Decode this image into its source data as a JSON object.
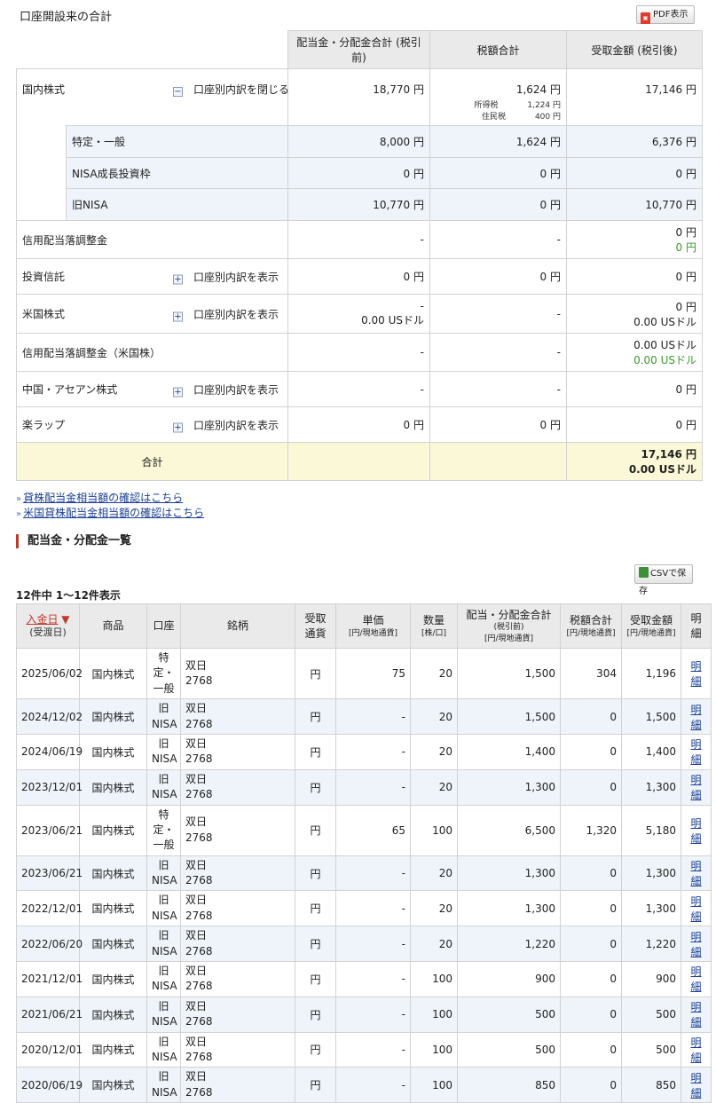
{
  "summary": {
    "title": "口座開設来の合計",
    "pdf_label": "PDF表示",
    "headers": {
      "dividend": "配当金・分配金合計 (税引前)",
      "tax": "税額合計",
      "received": "受取金額 (税引後)"
    },
    "domestic": {
      "label": "国内株式",
      "toggle": "口座別内訳を閉じる",
      "dividend": "18,770 円",
      "tax": "1,624 円",
      "income_tax_label": "所得税",
      "income_tax": "1,224 円",
      "resident_tax_label": "住民税",
      "resident_tax": "400 円",
      "received": "17,146 円",
      "accounts": [
        {
          "label": "特定・一般",
          "dividend": "8,000 円",
          "tax": "1,624 円",
          "received": "6,376 円"
        },
        {
          "label": "NISA成長投資枠",
          "dividend": "0 円",
          "tax": "0 円",
          "received": "0 円"
        },
        {
          "label": "旧NISA",
          "dividend": "10,770 円",
          "tax": "0 円",
          "received": "10,770 円"
        }
      ]
    },
    "margin_adj": {
      "label": "信用配当落調整金",
      "dividend": "-",
      "tax": "-",
      "received": "0 円",
      "received_green": "0 円"
    },
    "trust": {
      "label": "投資信託",
      "toggle": "口座別内訳を表示",
      "dividend": "0 円",
      "tax": "0 円",
      "received": "0 円"
    },
    "us": {
      "label": "米国株式",
      "toggle": "口座別内訳を表示",
      "dividend": "-",
      "dividend_usd": "0.00 USドル",
      "tax": "-",
      "received": "0 円",
      "received_usd": "0.00 USドル"
    },
    "us_margin_adj": {
      "label": "信用配当落調整金（米国株）",
      "dividend": "-",
      "tax": "-",
      "received": "0.00 USドル",
      "received_green": "0.00 USドル"
    },
    "asean": {
      "label": "中国・アセアン株式",
      "toggle": "口座別内訳を表示",
      "dividend": "-",
      "tax": "-",
      "received": "0 円"
    },
    "wrap": {
      "label": "楽ラップ",
      "toggle": "口座別内訳を表示",
      "dividend": "0 円",
      "tax": "0 円",
      "received": "0 円"
    },
    "total": {
      "label": "合計",
      "received": "17,146 円",
      "received_usd": "0.00 USドル"
    }
  },
  "links": [
    "貸株配当金相当額の確認はこちら",
    "米国貸株配当金相当額の確認はこちら"
  ],
  "list_section": {
    "title": "配当金・分配金一覧",
    "csv_label": "CSVで保存",
    "count": "12件中 1〜12件表示",
    "headers": {
      "date": "入金日",
      "date_arrow": "▼",
      "date_sub": "(受渡日)",
      "product": "商品",
      "account": "口座",
      "brand": "銘柄",
      "currency_1": "受取",
      "currency_2": "通貨",
      "unit_price": "単価",
      "unit_price_sub": "[円/現地通貨]",
      "qty": "数量",
      "qty_sub": "[株/口]",
      "dividend": "配当・分配金合計",
      "dividend_sub1": "(税引前)",
      "dividend_sub2": "[円/現地通貨]",
      "tax": "税額合計",
      "tax_sub": "[円/現地通貨]",
      "received": "受取金額",
      "received_sub": "[円/現地通貨]",
      "detail": "明細"
    },
    "rows": [
      {
        "date": "2025/06/02",
        "product": "国内株式",
        "account": [
          "特",
          "定・",
          "一般"
        ],
        "brand": "双日",
        "code": "2768",
        "currency": "円",
        "price": "75",
        "qty": "20",
        "dividend": "1,500",
        "tax": "304",
        "received": "1,196",
        "detail": "明細"
      },
      {
        "date": "2024/12/02",
        "product": "国内株式",
        "account": [
          "旧",
          "NISA"
        ],
        "brand": "双日",
        "code": "2768",
        "currency": "円",
        "price": "-",
        "qty": "20",
        "dividend": "1,500",
        "tax": "0",
        "received": "1,500",
        "detail": "明細"
      },
      {
        "date": "2024/06/19",
        "product": "国内株式",
        "account": [
          "旧",
          "NISA"
        ],
        "brand": "双日",
        "code": "2768",
        "currency": "円",
        "price": "-",
        "qty": "20",
        "dividend": "1,400",
        "tax": "0",
        "received": "1,400",
        "detail": "明細"
      },
      {
        "date": "2023/12/01",
        "product": "国内株式",
        "account": [
          "旧",
          "NISA"
        ],
        "brand": "双日",
        "code": "2768",
        "currency": "円",
        "price": "-",
        "qty": "20",
        "dividend": "1,300",
        "tax": "0",
        "received": "1,300",
        "detail": "明細"
      },
      {
        "date": "2023/06/21",
        "product": "国内株式",
        "account": [
          "特",
          "定・",
          "一般"
        ],
        "brand": "双日",
        "code": "2768",
        "currency": "円",
        "price": "65",
        "qty": "100",
        "dividend": "6,500",
        "tax": "1,320",
        "received": "5,180",
        "detail": "明細"
      },
      {
        "date": "2023/06/21",
        "product": "国内株式",
        "account": [
          "旧",
          "NISA"
        ],
        "brand": "双日",
        "code": "2768",
        "currency": "円",
        "price": "-",
        "qty": "20",
        "dividend": "1,300",
        "tax": "0",
        "received": "1,300",
        "detail": "明細"
      },
      {
        "date": "2022/12/01",
        "product": "国内株式",
        "account": [
          "旧",
          "NISA"
        ],
        "brand": "双日",
        "code": "2768",
        "currency": "円",
        "price": "-",
        "qty": "20",
        "dividend": "1,300",
        "tax": "0",
        "received": "1,300",
        "detail": "明細"
      },
      {
        "date": "2022/06/20",
        "product": "国内株式",
        "account": [
          "旧",
          "NISA"
        ],
        "brand": "双日",
        "code": "2768",
        "currency": "円",
        "price": "-",
        "qty": "20",
        "dividend": "1,220",
        "tax": "0",
        "received": "1,220",
        "detail": "明細"
      },
      {
        "date": "2021/12/01",
        "product": "国内株式",
        "account": [
          "旧",
          "NISA"
        ],
        "brand": "双日",
        "code": "2768",
        "currency": "円",
        "price": "-",
        "qty": "100",
        "dividend": "900",
        "tax": "0",
        "received": "900",
        "detail": "明細"
      },
      {
        "date": "2021/06/21",
        "product": "国内株式",
        "account": [
          "旧",
          "NISA"
        ],
        "brand": "双日",
        "code": "2768",
        "currency": "円",
        "price": "-",
        "qty": "100",
        "dividend": "500",
        "tax": "0",
        "received": "500",
        "detail": "明細"
      },
      {
        "date": "2020/12/01",
        "product": "国内株式",
        "account": [
          "旧",
          "NISA"
        ],
        "brand": "双日",
        "code": "2768",
        "currency": "円",
        "price": "-",
        "qty": "100",
        "dividend": "500",
        "tax": "0",
        "received": "500",
        "detail": "明細"
      },
      {
        "date": "2020/06/19",
        "product": "国内株式",
        "account": [
          "旧",
          "NISA"
        ],
        "brand": "双日",
        "code": "2768",
        "currency": "円",
        "price": "-",
        "qty": "100",
        "dividend": "850",
        "tax": "0",
        "received": "850",
        "detail": "明細"
      }
    ]
  },
  "colors": {
    "accent_red": "#c0392b",
    "link_blue": "#1a3f95",
    "row_blue": "#eef4fa",
    "total_yellow": "#fbf8d7",
    "green": "#3a9a2a"
  }
}
